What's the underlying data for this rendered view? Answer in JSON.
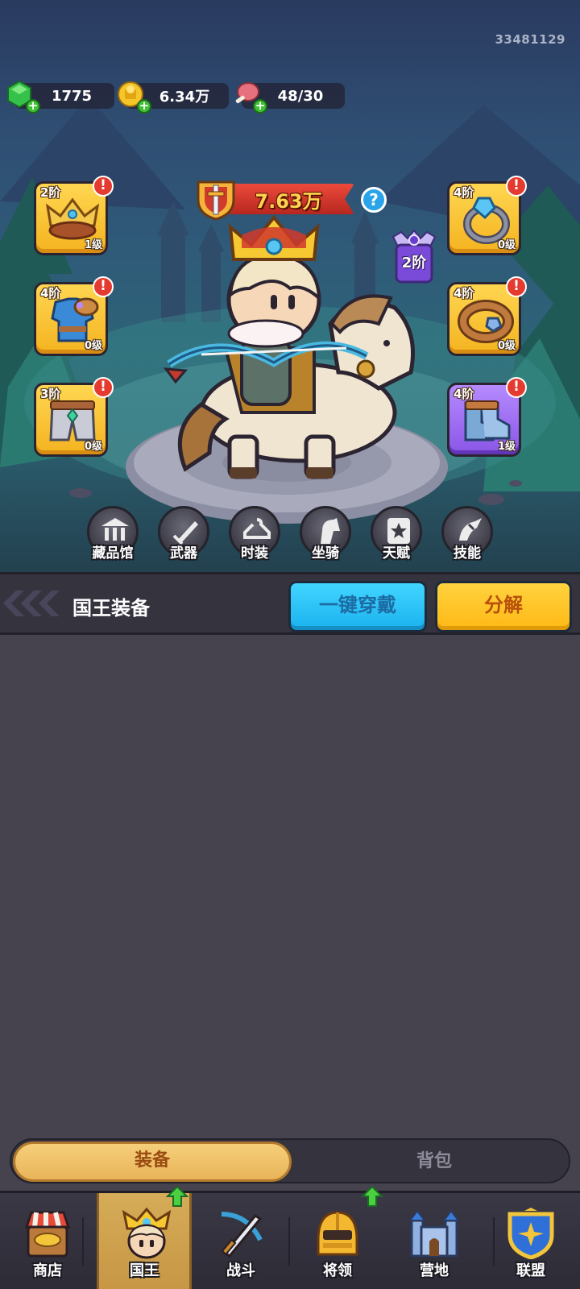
{
  "player_id": "33481129",
  "resources": [
    {
      "name": "gems",
      "icon": "green-gem-icon",
      "value": "1775"
    },
    {
      "name": "gold",
      "icon": "gold-coin-icon",
      "value": "6.34万"
    },
    {
      "name": "meat",
      "icon": "meat-icon",
      "value": "48/30"
    }
  ],
  "power": {
    "value": "7.63万",
    "help": "?"
  },
  "rank": {
    "label": "2阶"
  },
  "slots": {
    "crown": {
      "tier": "2阶",
      "level": "1级",
      "alert": "!"
    },
    "armor": {
      "tier": "4阶",
      "level": "0级",
      "alert": "!"
    },
    "pants": {
      "tier": "3阶",
      "level": "0级",
      "alert": "!"
    },
    "ring": {
      "tier": "4阶",
      "level": "0级",
      "alert": "!"
    },
    "belt": {
      "tier": "4阶",
      "level": "0级",
      "alert": "!"
    },
    "boots": {
      "tier": "4阶",
      "level": "1级",
      "alert": "!"
    }
  },
  "menu": [
    {
      "label": "藏品馆",
      "icon": "museum-icon"
    },
    {
      "label": "武器",
      "icon": "weapon-icon"
    },
    {
      "label": "时装",
      "icon": "fashion-icon"
    },
    {
      "label": "坐骑",
      "icon": "mount-icon"
    },
    {
      "label": "天赋",
      "icon": "talent-icon"
    },
    {
      "label": "技能",
      "icon": "skill-icon"
    }
  ],
  "equipment": {
    "title": "国王装备",
    "equip_all": "一键穿戴",
    "decompose": "分解"
  },
  "tabs": {
    "active": "装备",
    "inactive": "背包"
  },
  "nav": [
    {
      "label": "商店",
      "icon": "shop-icon"
    },
    {
      "label": "国王",
      "icon": "king-icon"
    },
    {
      "label": "战斗",
      "icon": "battle-icon"
    },
    {
      "label": "将领",
      "icon": "general-icon"
    },
    {
      "label": "营地",
      "icon": "camp-icon"
    },
    {
      "label": "联盟",
      "icon": "alliance-icon"
    }
  ],
  "colors": {
    "accent_gold": "#ffb915",
    "accent_blue": "#1ab2ef",
    "panel_bg": "#46434f",
    "power_text": "#ffd34d"
  }
}
